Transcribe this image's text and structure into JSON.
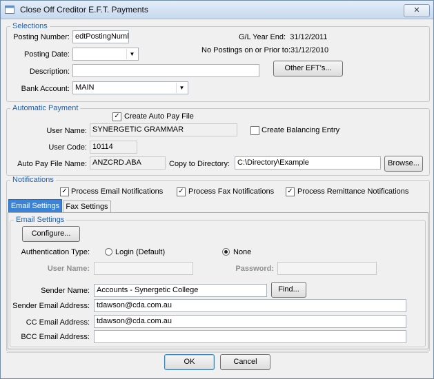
{
  "window": {
    "title": "Close Off Creditor E.F.T. Payments",
    "close_label": "✕"
  },
  "selections": {
    "group_title": "Selections",
    "posting_number_label": "Posting Number:",
    "posting_number_value": "edtPostingNumb",
    "gl_year_end_label": "G/L Year End:",
    "gl_year_end_value": "31/12/2011",
    "posting_date_label": "Posting Date:",
    "posting_date_value": "",
    "no_postings_label": "No Postings on or Prior to:",
    "no_postings_value": "31/12/2010",
    "description_label": "Description:",
    "description_value": "",
    "other_efts_label": "Other EFT's...",
    "bank_account_label": "Bank Account:",
    "bank_account_value": "MAIN"
  },
  "automatic_payment": {
    "group_title": "Automatic Payment",
    "create_auto_pay_file_label": "Create Auto Pay File",
    "create_auto_pay_file_checked": true,
    "user_name_label": "User Name:",
    "user_name_value": "SYNERGETIC GRAMMAR",
    "create_balancing_entry_label": "Create Balancing Entry",
    "create_balancing_entry_checked": false,
    "user_code_label": "User Code:",
    "user_code_value": "10114",
    "auto_pay_file_name_label": "Auto Pay File Name:",
    "auto_pay_file_name_value": "ANZCRD.ABA",
    "copy_to_directory_label": "Copy to Directory:",
    "copy_to_directory_value": "C:\\Directory\\Example",
    "browse_label": "Browse..."
  },
  "notifications": {
    "group_title": "Notifications",
    "process_email_label": "Process Email Notifications",
    "process_email_checked": true,
    "process_fax_label": "Process Fax Notifications",
    "process_fax_checked": true,
    "process_remittance_label": "Process Remittance Notifications",
    "process_remittance_checked": true,
    "tabs": [
      {
        "label": "Email Settings",
        "active": true
      },
      {
        "label": "Fax Settings",
        "active": false
      }
    ]
  },
  "email_settings": {
    "group_title": "Email Settings",
    "configure_label": "Configure...",
    "auth_type_label": "Authentication Type:",
    "login_default_label": "Login (Default)",
    "none_label": "None",
    "selected_auth": "None",
    "user_name_label": "User Name:",
    "user_name_value": "",
    "password_label": "Password:",
    "password_value": "",
    "sender_name_label": "Sender Name:",
    "sender_name_value": "Accounts - Synergetic College",
    "find_label": "Find...",
    "sender_email_label": "Sender Email Address:",
    "sender_email_value": "tdawson@cda.com.au",
    "cc_email_label": "CC Email Address:",
    "cc_email_value": "tdawson@cda.com.au",
    "bcc_email_label": "BCC Email Address:",
    "bcc_email_value": ""
  },
  "footer": {
    "ok_label": "OK",
    "cancel_label": "Cancel"
  },
  "icons": {
    "window_icon": "dialog-window-icon",
    "dropdown_arrow": "▼",
    "check_mark": "✓"
  }
}
